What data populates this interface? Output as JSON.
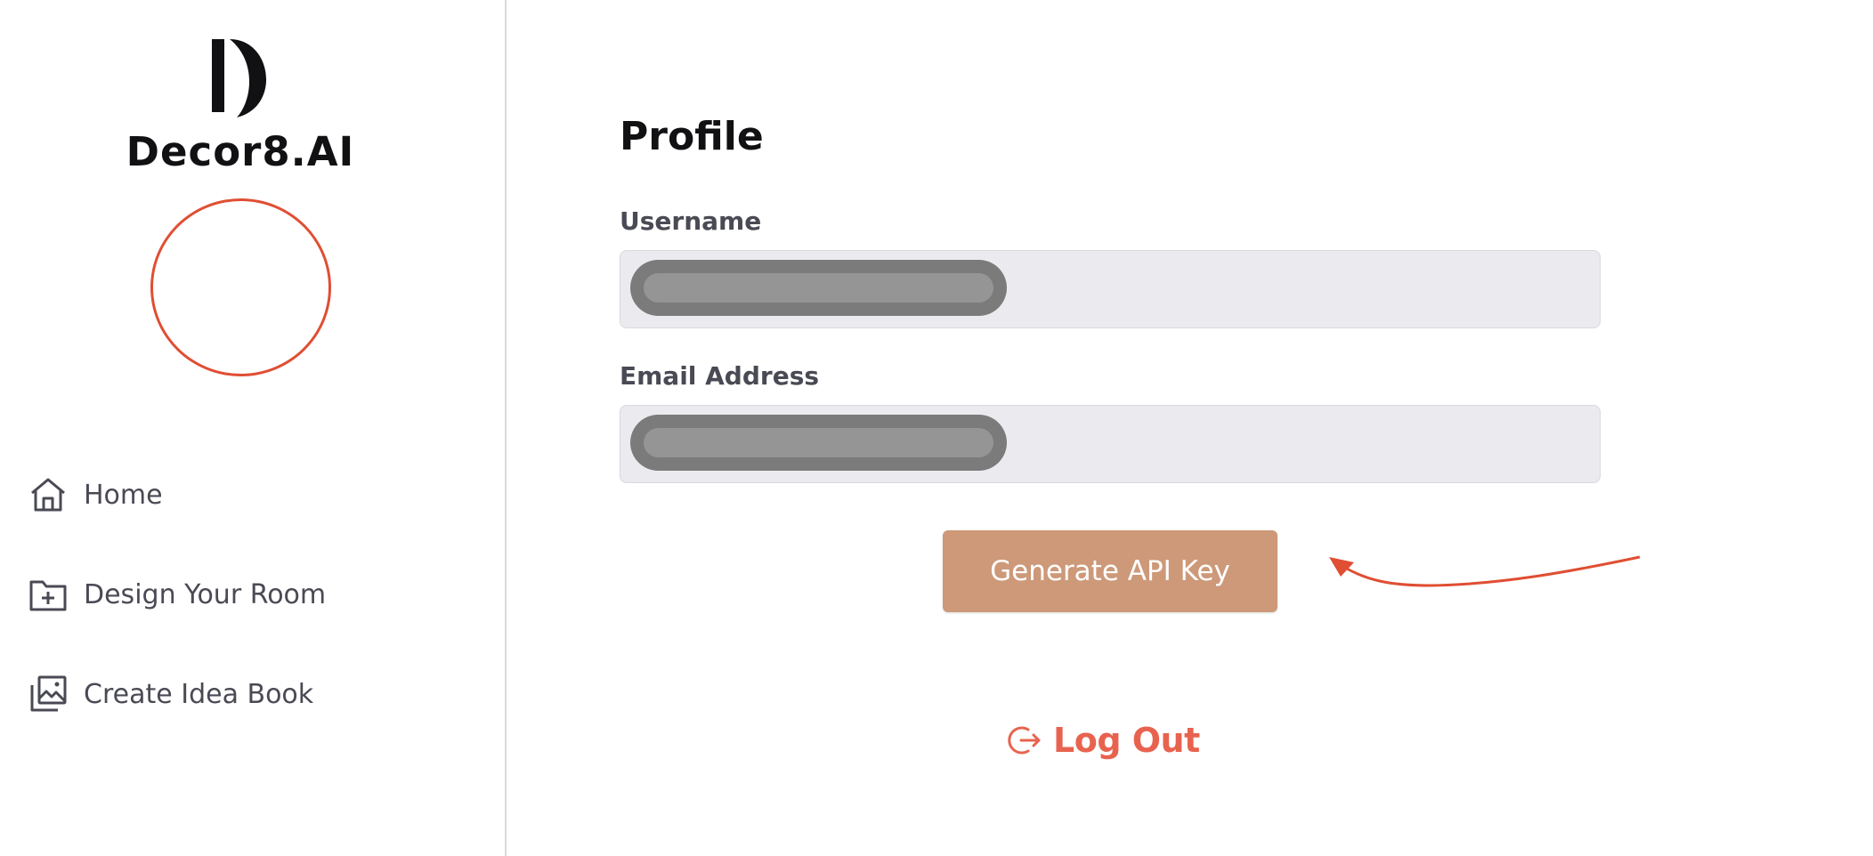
{
  "brand": {
    "name": "Decor8.AI",
    "logo_icon": "decor8-logo-icon"
  },
  "colors": {
    "accent": "#e04e33",
    "button": "#cd9979",
    "logout": "#e8634f",
    "nav_text": "#4a4a55"
  },
  "sidebar": {
    "items": [
      {
        "label": "Home",
        "icon": "home-icon"
      },
      {
        "label": "Design Your Room",
        "icon": "folder-plus-icon"
      },
      {
        "label": "Create Idea Book",
        "icon": "image-gallery-icon"
      }
    ]
  },
  "profile": {
    "title": "Profile",
    "username_label": "Username",
    "email_label": "Email Address",
    "generate_button": "Generate API Key",
    "logout_label": "Log Out"
  }
}
